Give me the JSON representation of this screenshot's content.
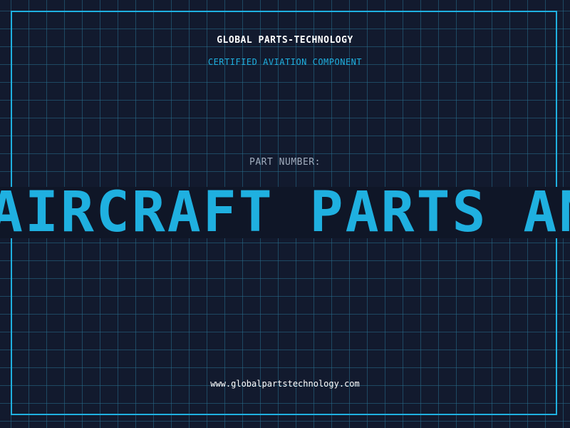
{
  "header": {
    "company_name": "GLOBAL PARTS-TECHNOLOGY",
    "tagline": "CERTIFIED AVIATION COMPONENT"
  },
  "part": {
    "label": "PART NUMBER:",
    "value": "AIRCRAFT PARTS ANCH"
  },
  "footer": {
    "website": "www.globalpartstechnology.com"
  },
  "colors": {
    "background": "#121a2e",
    "accent": "#1fb0e0",
    "grid": "#286e8c",
    "label": "#a0acbd",
    "text": "#ffffff"
  }
}
